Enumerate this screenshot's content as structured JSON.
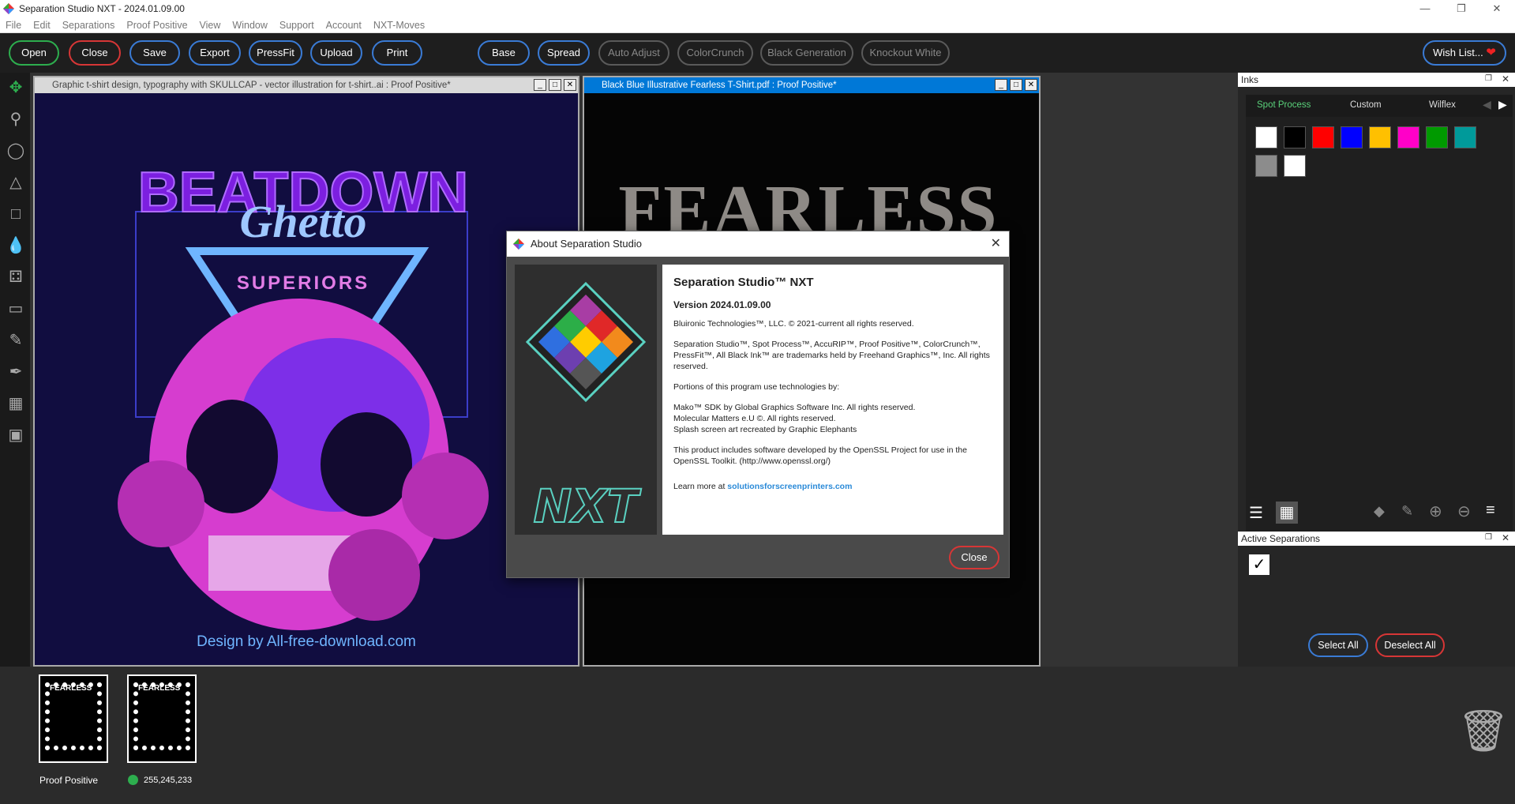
{
  "window": {
    "title": "Separation Studio NXT - 2024.01.09.00"
  },
  "menu": [
    "File",
    "Edit",
    "Separations",
    "Proof Positive",
    "View",
    "Window",
    "Support",
    "Account",
    "NXT-Moves"
  ],
  "toolbar": {
    "open": "Open",
    "close": "Close",
    "save": "Save",
    "export": "Export",
    "pressfit": "PressFit",
    "upload": "Upload",
    "print": "Print",
    "base": "Base",
    "spread": "Spread",
    "auto_adjust": "Auto Adjust",
    "colorcrunch": "ColorCrunch",
    "black_generation": "Black Generation",
    "knockout_white": "Knockout White",
    "wish_list": "Wish List...",
    "heart_icon": "heart"
  },
  "doc1": {
    "title": "Graphic t-shirt design, typography with SKULLCAP  - vector illustration for t-shirt..ai : Proof Positive*",
    "art": {
      "line1": "BEATDOWN",
      "line2": "Ghetto",
      "line3": "SUPERIORS",
      "footer": "Design by All-free-download.com"
    }
  },
  "doc2": {
    "title": "Black Blue Illustrative Fearless T-Shirt.pdf : Proof Positive*",
    "art": {
      "headline": "FEARLESS"
    }
  },
  "inks": {
    "header": "Inks",
    "tabs": [
      "Spot Process",
      "Custom",
      "Wilflex"
    ],
    "swatches": [
      "#ffffff",
      "#000000",
      "#ff0000",
      "#0000ff",
      "#ffc000",
      "#ff00c8",
      "#009a00",
      "#009a9a",
      "#8c8c8c",
      "#ffffff"
    ]
  },
  "active_separations": {
    "header": "Active Separations",
    "select_all": "Select All",
    "deselect_all": "Deselect All"
  },
  "bottom": {
    "label1": "Proof Positive",
    "label2": "255,245,233",
    "thumb_text": "FEARLESS"
  },
  "dialog": {
    "title": "About Separation Studio",
    "logo_text": "NXT",
    "product": "Separation Studio™ NXT",
    "version": "Version 2024.01.09.00",
    "copyright": "Bluironic Technologies™, LLC. © 2021-current all rights reserved.",
    "trademarks": "Separation Studio™, Spot Process™, AccuRIP™, Proof Positive™, ColorCrunch™, PressFit™, All Black Ink™ are trademarks held by Freehand Graphics™, Inc. All rights reserved.",
    "portions": "Portions of this program use technologies by:",
    "mako": "Mako™ SDK by Global Graphics Software Inc. All rights reserved.",
    "molecular": "Molecular Matters e.U ©. All rights reserved.",
    "splash": "Splash screen art recreated by Graphic Elephants",
    "openssl": "This product includes software developed by the OpenSSL Project for use in the OpenSSL Toolkit. (http://www.openssl.org/)",
    "learn_prefix": "Learn more at ",
    "learn_link": "solutionsforscreenprinters.com",
    "close": "Close"
  }
}
